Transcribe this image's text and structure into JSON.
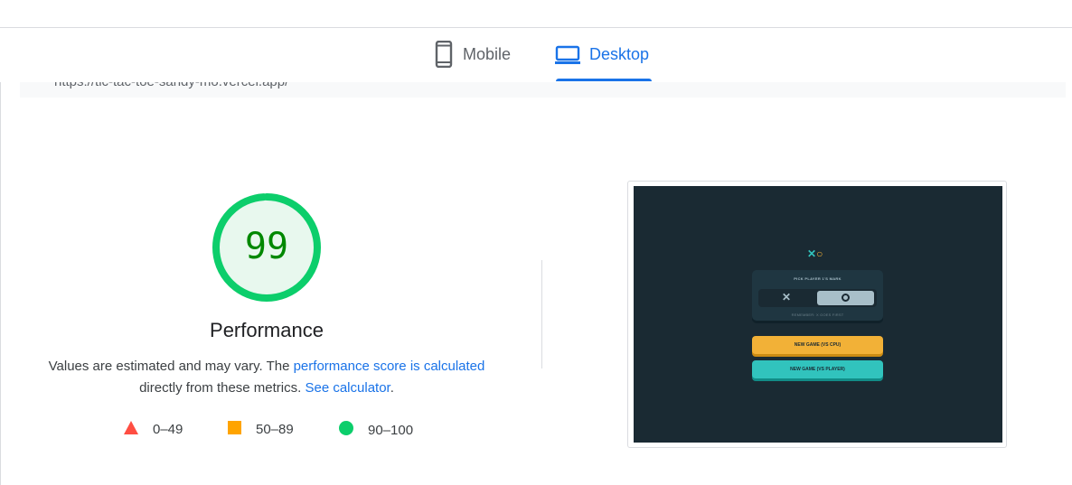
{
  "tabs": {
    "mobile_label": "Mobile",
    "desktop_label": "Desktop",
    "active": "Desktop"
  },
  "url": "https://tic-tac-toe-sandy-mo.vercel.app/",
  "performance": {
    "score": "99",
    "title": "Performance",
    "desc_prefix": "Values are estimated and may vary. The ",
    "desc_link1": "performance score is calculated",
    "desc_middle": " directly from these metrics. ",
    "desc_link2": "See calculator",
    "desc_suffix": "."
  },
  "legend": {
    "fail": "0–49",
    "average": "50–89",
    "pass": "90–100"
  },
  "colors": {
    "accent": "#1a73e8",
    "pass": "#0cce6b",
    "average": "#ffa400",
    "fail": "#ff4e42",
    "score_text": "#008800"
  },
  "screenshot": {
    "pick_title": "PICK PLAYER 1'S MARK",
    "pick_note": "REMEMBER: X GOES FIRST",
    "btn_cpu": "NEW GAME (VS CPU)",
    "btn_player": "NEW GAME (VS PLAYER)"
  },
  "icons": {
    "mobile": "phone-icon",
    "desktop": "laptop-icon"
  }
}
